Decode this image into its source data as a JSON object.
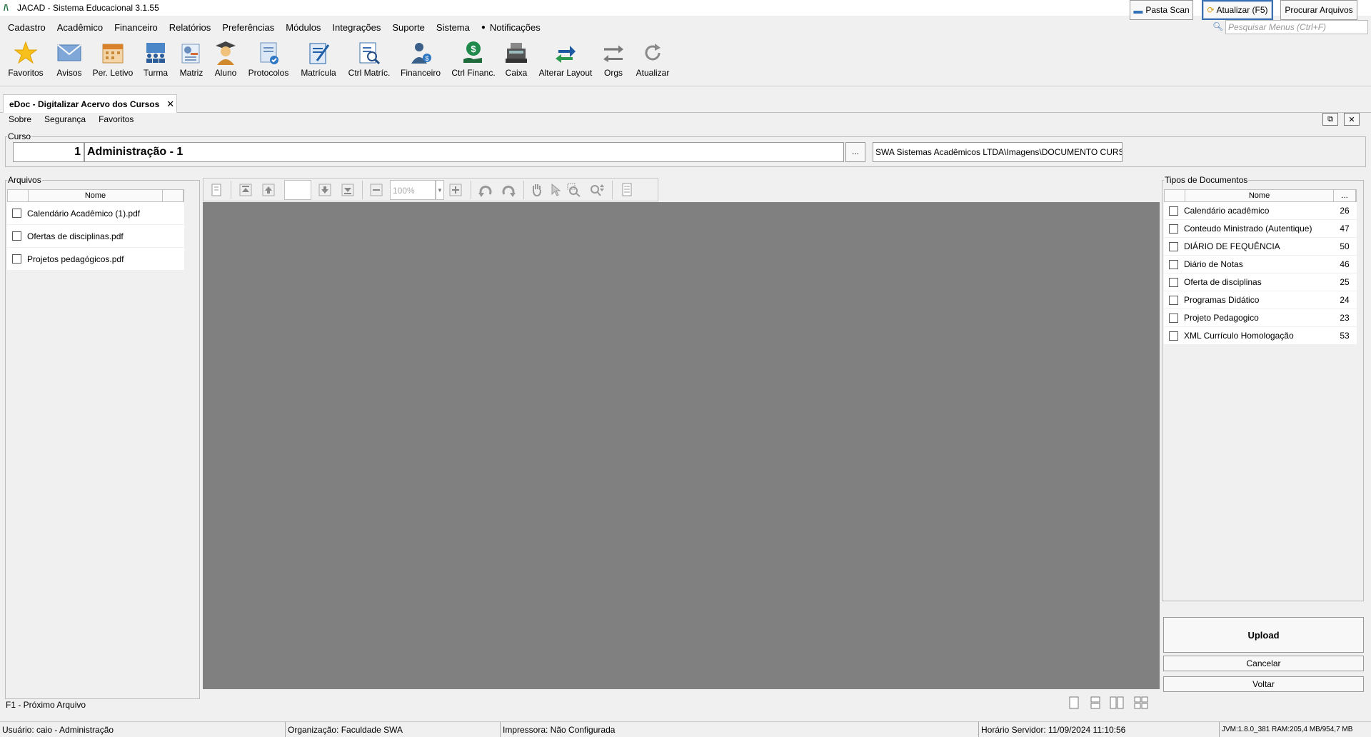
{
  "window": {
    "title": "JACAD - Sistema Educacional 3.1.55",
    "minimize": "─",
    "maximize": "❐",
    "close": "✕"
  },
  "menubar": {
    "items": [
      "Cadastro",
      "Acadêmico",
      "Financeiro",
      "Relatórios",
      "Preferências",
      "Módulos",
      "Integrações",
      "Suporte",
      "Sistema",
      "Notificações"
    ],
    "search_placeholder": "Pesquisar Menus (Ctrl+F)"
  },
  "toolbar": {
    "items": [
      {
        "label": "Favoritos",
        "icon": "star-icon"
      },
      {
        "label": "Avisos",
        "icon": "envelope-icon"
      },
      {
        "label": "Per. Letivo",
        "icon": "calendar-icon"
      },
      {
        "label": "Turma",
        "icon": "class-group-icon"
      },
      {
        "label": "Matriz",
        "icon": "matrix-icon"
      },
      {
        "label": "Aluno",
        "icon": "student-icon"
      },
      {
        "label": "Protocolos",
        "icon": "protocol-icon"
      },
      {
        "label": "Matrícula",
        "icon": "enrollment-icon"
      },
      {
        "label": "Ctrl Matríc.",
        "icon": "enrollment-control-icon"
      },
      {
        "label": "Financeiro",
        "icon": "finance-user-icon"
      },
      {
        "label": "Ctrl Financ.",
        "icon": "money-hand-icon"
      },
      {
        "label": "Caixa",
        "icon": "cash-register-icon"
      },
      {
        "label": "Alterar Layout",
        "icon": "swap-layout-icon"
      },
      {
        "label": "Orgs",
        "icon": "arrows-exchange-icon"
      },
      {
        "label": "Atualizar",
        "icon": "refresh-icon"
      }
    ]
  },
  "tab": {
    "label": "eDoc - Digitalizar Acervo dos Cursos",
    "close": "✕"
  },
  "submenu": [
    "Sobre",
    "Segurança",
    "Favoritos"
  ],
  "curso": {
    "legend": "Curso",
    "code": "1",
    "name": "Administração - 1",
    "dots": "...",
    "path": "SWA Sistemas Acadêmicos LTDA\\Imagens\\DOCUMENTO CURSO",
    "pasta_scan": "Pasta Scan",
    "atualizar": "Atualizar (F5)",
    "procurar": "Procurar Arquivos"
  },
  "arquivos": {
    "legend": "Arquivos",
    "col_nome": "Nome",
    "rows": [
      "Calendário Acadêmico (1).pdf",
      "Ofertas de disciplinas.pdf",
      "Projetos pedagógicos.pdf"
    ],
    "footer": "F1 - Próximo Arquivo"
  },
  "viewer": {
    "zoom": "100%"
  },
  "tipos": {
    "legend": "Tipos de Documentos",
    "col_nome": "Nome",
    "col_extra": "...",
    "rows": [
      {
        "nome": "Calendário acadêmico",
        "num": "26"
      },
      {
        "nome": "Conteudo Ministrado (Autentique)",
        "num": "47"
      },
      {
        "nome": "DIÁRIO DE FEQUÊNCIA",
        "num": "50"
      },
      {
        "nome": "Diário de Notas",
        "num": "46"
      },
      {
        "nome": "Oferta de disciplinas",
        "num": "25"
      },
      {
        "nome": "Programas Didático",
        "num": "24"
      },
      {
        "nome": "Projeto Pedagogico",
        "num": "23"
      },
      {
        "nome": "XML Currículo Homologação",
        "num": "53"
      }
    ]
  },
  "actions": {
    "upload": "Upload",
    "cancelar": "Cancelar",
    "voltar": "Voltar"
  },
  "statusbar": {
    "usuario": "Usuário: caio - Administração",
    "organizacao": "Organização: Faculdade SWA",
    "impressora": "Impressora: Não Configurada",
    "horario": "Horário Servidor: 11/09/2024 11:10:56",
    "jvm": "JVM:1.8.0_381  RAM:205,4 MB/954,7 MB"
  }
}
